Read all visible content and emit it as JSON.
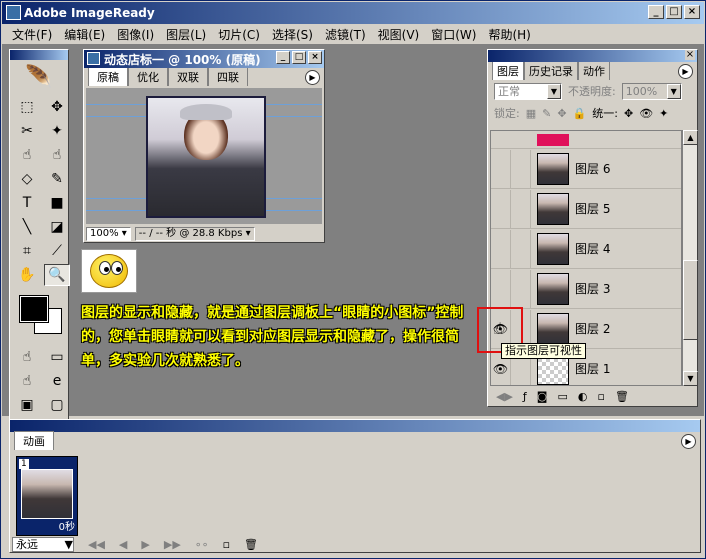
{
  "app": {
    "title": "Adobe ImageReady"
  },
  "menubar": {
    "items": [
      "文件(F)",
      "编辑(E)",
      "图像(I)",
      "图层(L)",
      "切片(C)",
      "选择(S)",
      "滤镜(T)",
      "视图(V)",
      "窗口(W)",
      "帮助(H)"
    ]
  },
  "document": {
    "title": "动态店标一 @ 100% (原稿)",
    "tabs": [
      "原稿",
      "优化",
      "双联",
      "四联"
    ],
    "zoom": "100%",
    "status": "-- / -- 秒 @ 28.8 Kbps"
  },
  "annotation": {
    "text": "图层的显示和隐藏，就是通过图层调板上“眼睛的小图标”控制的，您单击眼睛就可以看到对应图层显示和隐藏了，操作很简单，多实验几次就熟悉了。"
  },
  "layers_panel": {
    "tabs": [
      "图层",
      "历史记录",
      "动作"
    ],
    "blend_mode": "正常",
    "opacity_label": "不透明度:",
    "opacity_value": "100%",
    "lock_label": "锁定:",
    "unify_label": "统一:",
    "layers": [
      "图层 6",
      "图层 5",
      "图层 4",
      "图层 3",
      "图层 2",
      "图层 1"
    ],
    "tooltip": "指示图层可视性",
    "accent_color": "#e0105a"
  },
  "animation_panel": {
    "tab": "动画",
    "frame_number": "1",
    "frame_delay": "0秒",
    "loop": "永远"
  },
  "colors": {
    "foreground": "#000000",
    "background": "#ffffff",
    "highlight_box": "#e01010"
  }
}
